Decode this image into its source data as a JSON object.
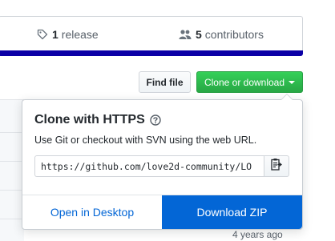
{
  "stats": {
    "release_count": "1",
    "release_label": "release",
    "contributors_count": "5",
    "contributors_label": "contributors",
    "language_bar_color": "#0b00a6"
  },
  "toolbar": {
    "find_file_label": "Find file",
    "clone_label": "Clone or download"
  },
  "clone_panel": {
    "title": "Clone with HTTPS",
    "description": "Use Git or checkout with SVN using the web URL.",
    "url": "https://github.com/love2d-community/LO",
    "open_desktop_label": "Open in Desktop",
    "download_zip_label": "Download ZIP"
  },
  "file_list": {
    "timestamp": "4 years ago"
  },
  "icons": {
    "release": "tag-icon",
    "contributors": "people-icon",
    "help": "question-icon",
    "copy": "clipboard-icon",
    "dropdown": "caret-down-icon"
  },
  "colors": {
    "primary_green": "#28a745",
    "link_blue": "#0366d6"
  }
}
